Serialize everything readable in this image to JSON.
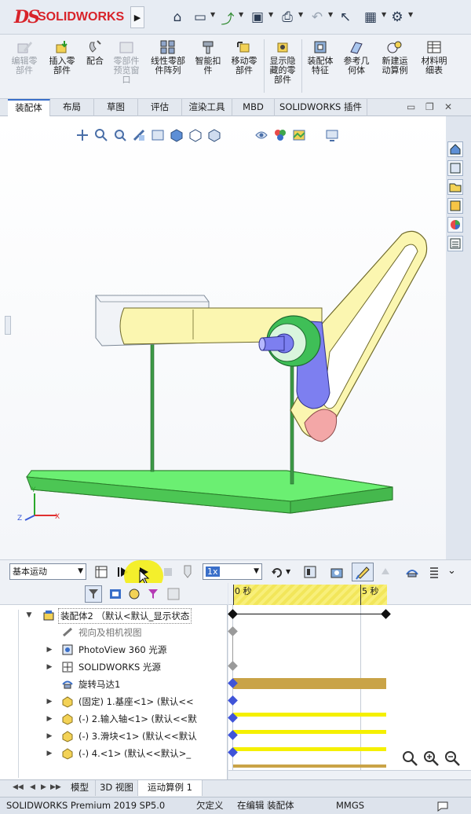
{
  "app": {
    "logo_text": "SOLIDWORKS",
    "logo_mark": "DS"
  },
  "quick_access": [
    {
      "name": "home-icon",
      "glyph": "⌂"
    },
    {
      "name": "new-document-icon",
      "glyph": "▭"
    },
    {
      "name": "open-icon",
      "glyph": "⤴"
    },
    {
      "name": "save-icon",
      "glyph": "▣"
    },
    {
      "name": "print-icon",
      "glyph": "⎙"
    },
    {
      "name": "undo-icon",
      "glyph": "↶"
    },
    {
      "name": "select-icon",
      "glyph": "↖"
    },
    {
      "name": "rebuild-icon",
      "glyph": "▦"
    },
    {
      "name": "options-icon",
      "glyph": "⚙"
    }
  ],
  "commands": [
    {
      "name": "edit-component",
      "label": "编辑零\n部件",
      "disabled": true
    },
    {
      "name": "insert-components",
      "label": "插入零\n部件",
      "disabled": false
    },
    {
      "name": "mate",
      "label": "配合",
      "disabled": false
    },
    {
      "name": "component-preview",
      "label": "零部件\n预览窗\n口",
      "disabled": true
    },
    {
      "name": "linear-pattern",
      "label": "线性零部\n件阵列",
      "disabled": false
    },
    {
      "name": "smart-fasteners",
      "label": "智能扣\n件",
      "disabled": false
    },
    {
      "name": "move-component",
      "label": "移动零\n部件",
      "disabled": false
    },
    {
      "name": "show-hidden",
      "label": "显示隐\n藏的零\n部件",
      "disabled": false
    },
    {
      "name": "assembly-features",
      "label": "装配体\n特征",
      "disabled": false
    },
    {
      "name": "reference-geometry",
      "label": "参考几\n何体",
      "disabled": false
    },
    {
      "name": "new-motion-study",
      "label": "新建运\n动算例",
      "disabled": false
    },
    {
      "name": "bill-of-materials",
      "label": "材料明\n细表",
      "disabled": false
    }
  ],
  "tabs": [
    "装配体",
    "布局",
    "草图",
    "评估",
    "渲染工具",
    "MBD",
    "SOLIDWORKS 插件"
  ],
  "colors": {
    "accent": "#3a6fc9",
    "base_green": "#57e35f",
    "part_yellow": "#fbf6b0",
    "roller_green": "#3fbf57",
    "slider_blue": "#7d7ff0",
    "crank_pink": "#f3a7a7",
    "timeline_gold": "#c9a347",
    "timeline_yellow": "#f5f000",
    "key_blue": "#3f54d8"
  },
  "motion": {
    "study_type": "基本运动",
    "speed": "1x",
    "time_start": "0 秒",
    "time_5": "5 秒"
  },
  "tree": {
    "root": "装配体2 （默认<默认_显示状态",
    "items": [
      {
        "label": "视向及相机视图",
        "icon": "camera-icon",
        "expander": false
      },
      {
        "label": "PhotoView 360 光源",
        "icon": "light-icon",
        "expander": true
      },
      {
        "label": "SOLIDWORKS 光源",
        "icon": "light-icon",
        "expander": true
      },
      {
        "label": "旋转马达1",
        "icon": "motor-icon",
        "expander": false
      },
      {
        "label": "(固定) 1.基座<1> (默认<<",
        "icon": "part-icon",
        "expander": true
      },
      {
        "label": "(-) 2.输入轴<1> (默认<<默",
        "icon": "part-icon",
        "expander": true
      },
      {
        "label": "(-) 3.滑块<1> (默认<<默认",
        "icon": "part-icon",
        "expander": true
      },
      {
        "label": "(-) 4.<1> (默认<<默认>_",
        "icon": "part-icon",
        "expander": true
      }
    ]
  },
  "bottom_tabs": [
    "模型",
    "3D 视图",
    "运动算例 1"
  ],
  "status": {
    "product": "SOLIDWORKS Premium 2019 SP5.0",
    "definition": "欠定义",
    "editing": "在编辑 装配体",
    "units": "MMGS"
  }
}
